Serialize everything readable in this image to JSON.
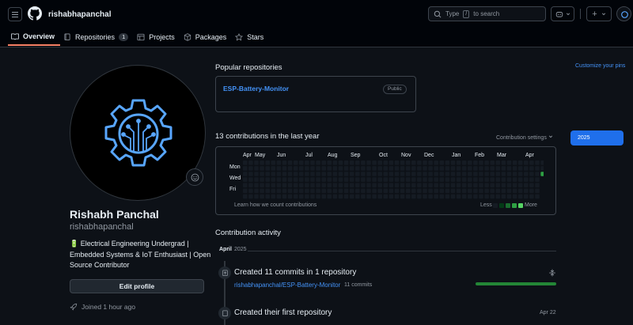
{
  "header": {
    "username": "rishabhapanchal",
    "search": {
      "prefix": "Type",
      "key": "/",
      "suffix": "to search"
    },
    "plus_label": "+"
  },
  "tabs": [
    {
      "label": "Overview",
      "icon": "book-icon",
      "active": true
    },
    {
      "label": "Repositories",
      "icon": "repo-icon",
      "count": "1"
    },
    {
      "label": "Projects",
      "icon": "table-icon"
    },
    {
      "label": "Packages",
      "icon": "package-icon"
    },
    {
      "label": "Stars",
      "icon": "star-icon"
    }
  ],
  "profile": {
    "display_name": "Rishabh Panchal",
    "login": "rishabhapanchal",
    "bio_emoji": "🔋",
    "bio": "Electrical Engineering Undergrad | Embedded Systems & IoT Enthusiast | Open Source Contributor",
    "edit_label": "Edit profile",
    "joined": "Joined 1 hour ago"
  },
  "popular": {
    "title": "Popular repositories",
    "customize": "Customize your pins",
    "repo_name": "ESP-Battery-Monitor",
    "visibility": "Public"
  },
  "contributions": {
    "title": "13 contributions in the last year",
    "settings": "Contribution settings",
    "year": "2025",
    "months": [
      "Apr",
      "May",
      "Jun",
      "Jul",
      "Aug",
      "Sep",
      "Oct",
      "Nov",
      "Dec",
      "Jan",
      "Feb",
      "Mar",
      "Apr"
    ],
    "days": [
      "Mon",
      "Wed",
      "Fri"
    ],
    "learn": "Learn how we count contributions",
    "less": "Less",
    "more": "More",
    "colors": {
      "empty": "#151b23",
      "l1": "#033a16",
      "l2": "#196c2e",
      "l3": "#2ea043",
      "l4": "#56d364"
    },
    "active_cell": {
      "week": 53,
      "day": 2,
      "level": 3
    }
  },
  "activity": {
    "title": "Contribution activity",
    "month": "April",
    "year": "2025",
    "item1": {
      "title": "Created 11 commits in 1 repository",
      "repo": "rishabhapanchal/ESP-Battery-Monitor",
      "commits": "11 commits",
      "share": 1.0
    },
    "item2": {
      "title": "Created their first repository",
      "date": "Apr 22"
    }
  }
}
